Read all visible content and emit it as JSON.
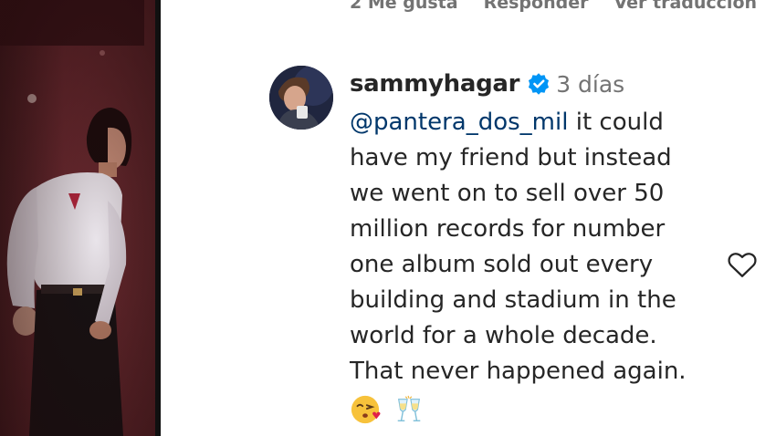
{
  "previous_comment_actions": {
    "likes": "2 Me gusta",
    "reply": "Responder",
    "translate": "Ver traducción"
  },
  "comment": {
    "username": "sammyhagar",
    "verified": true,
    "age": "3 días",
    "mention": "@pantera_dos_mil",
    "text": " it could have my friend but instead we went on to sell over 50 million records for number one album sold out every building and stadium in the world for a whole decade. That never happened again.",
    "emojis": [
      "face-blowing-a-kiss-emoji",
      "clinking-glasses-emoji"
    ]
  },
  "icons": {
    "verified": "verified-badge-icon",
    "like": "heart-outline-icon"
  },
  "colors": {
    "text": "#262626",
    "secondary": "#737373",
    "mention": "#00376b",
    "verified": "#0095f6"
  }
}
